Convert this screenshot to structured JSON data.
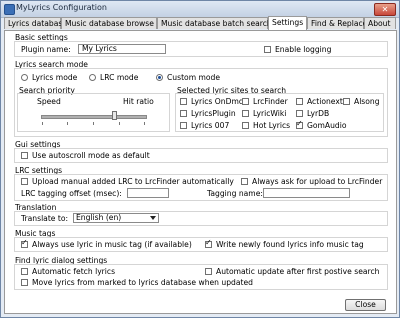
{
  "window": {
    "title": "MyLyrics Configuration",
    "close_label": "✕"
  },
  "tabs": [
    "Lyrics database",
    "Music database browse",
    "Music database batch search",
    "Settings",
    "Find & Replace",
    "About"
  ],
  "basic": {
    "heading": "Basic settings",
    "plugin_label": "Plugin name:",
    "plugin_value": "My Lyrics",
    "logging_label": "Enable logging",
    "logging": false
  },
  "search_mode": {
    "heading": "Lyrics search mode",
    "options": [
      "Lyrics mode",
      "LRC mode",
      "Custom mode"
    ],
    "selected": "Custom mode"
  },
  "priority": {
    "heading": "Search priority",
    "left_label": "Speed",
    "right_label": "Hit ratio",
    "level": 0.7
  },
  "sites": {
    "heading": "Selected lyric sites to search",
    "items": [
      {
        "label": "Lyrics OnDmd",
        "checked": false
      },
      {
        "label": "LrcFinder",
        "checked": false
      },
      {
        "label": "Actionext",
        "checked": false
      },
      {
        "label": "Alsong",
        "checked": false
      },
      {
        "label": "LyricsPlugin",
        "checked": false
      },
      {
        "label": "LyricWiki",
        "checked": false
      },
      {
        "label": "LyrDB",
        "checked": false
      },
      {
        "label": "Lyrics 007",
        "checked": false
      },
      {
        "label": "Hot Lyrics",
        "checked": false
      },
      {
        "label": "GomAudio",
        "checked": true
      }
    ]
  },
  "gui": {
    "heading": "Gui settings",
    "autoscroll_label": "Use autoscroll mode as default",
    "autoscroll": false
  },
  "lrc": {
    "heading": "LRC settings",
    "upload_label": "Upload manual added LRC to LrcFinder automatically",
    "upload": false,
    "ask_label": "Always ask for upload to LrcFinder",
    "ask": false,
    "offset_label": "LRC tagging offset (msec):",
    "offset_value": "",
    "tagname_label": "Tagging name:",
    "tagname_value": ""
  },
  "translation": {
    "heading": "Translation",
    "label": "Translate to:",
    "value": "English (en)"
  },
  "music_tags": {
    "heading": "Music tags",
    "use_label": "Always use lyric in music tag (if available)",
    "use": true,
    "write_label": "Write newly found lyrics info music tag",
    "write": true
  },
  "find_dialog": {
    "heading": "Find lyric dialog settings",
    "auto_fetch_label": "Automatic fetch lyrics",
    "auto_fetch": false,
    "auto_update_label": "Automatic update after first postive search",
    "auto_update": false,
    "move_label": "Move lyrics from marked to lyrics database when updated",
    "move": false
  },
  "close_button": "Close"
}
